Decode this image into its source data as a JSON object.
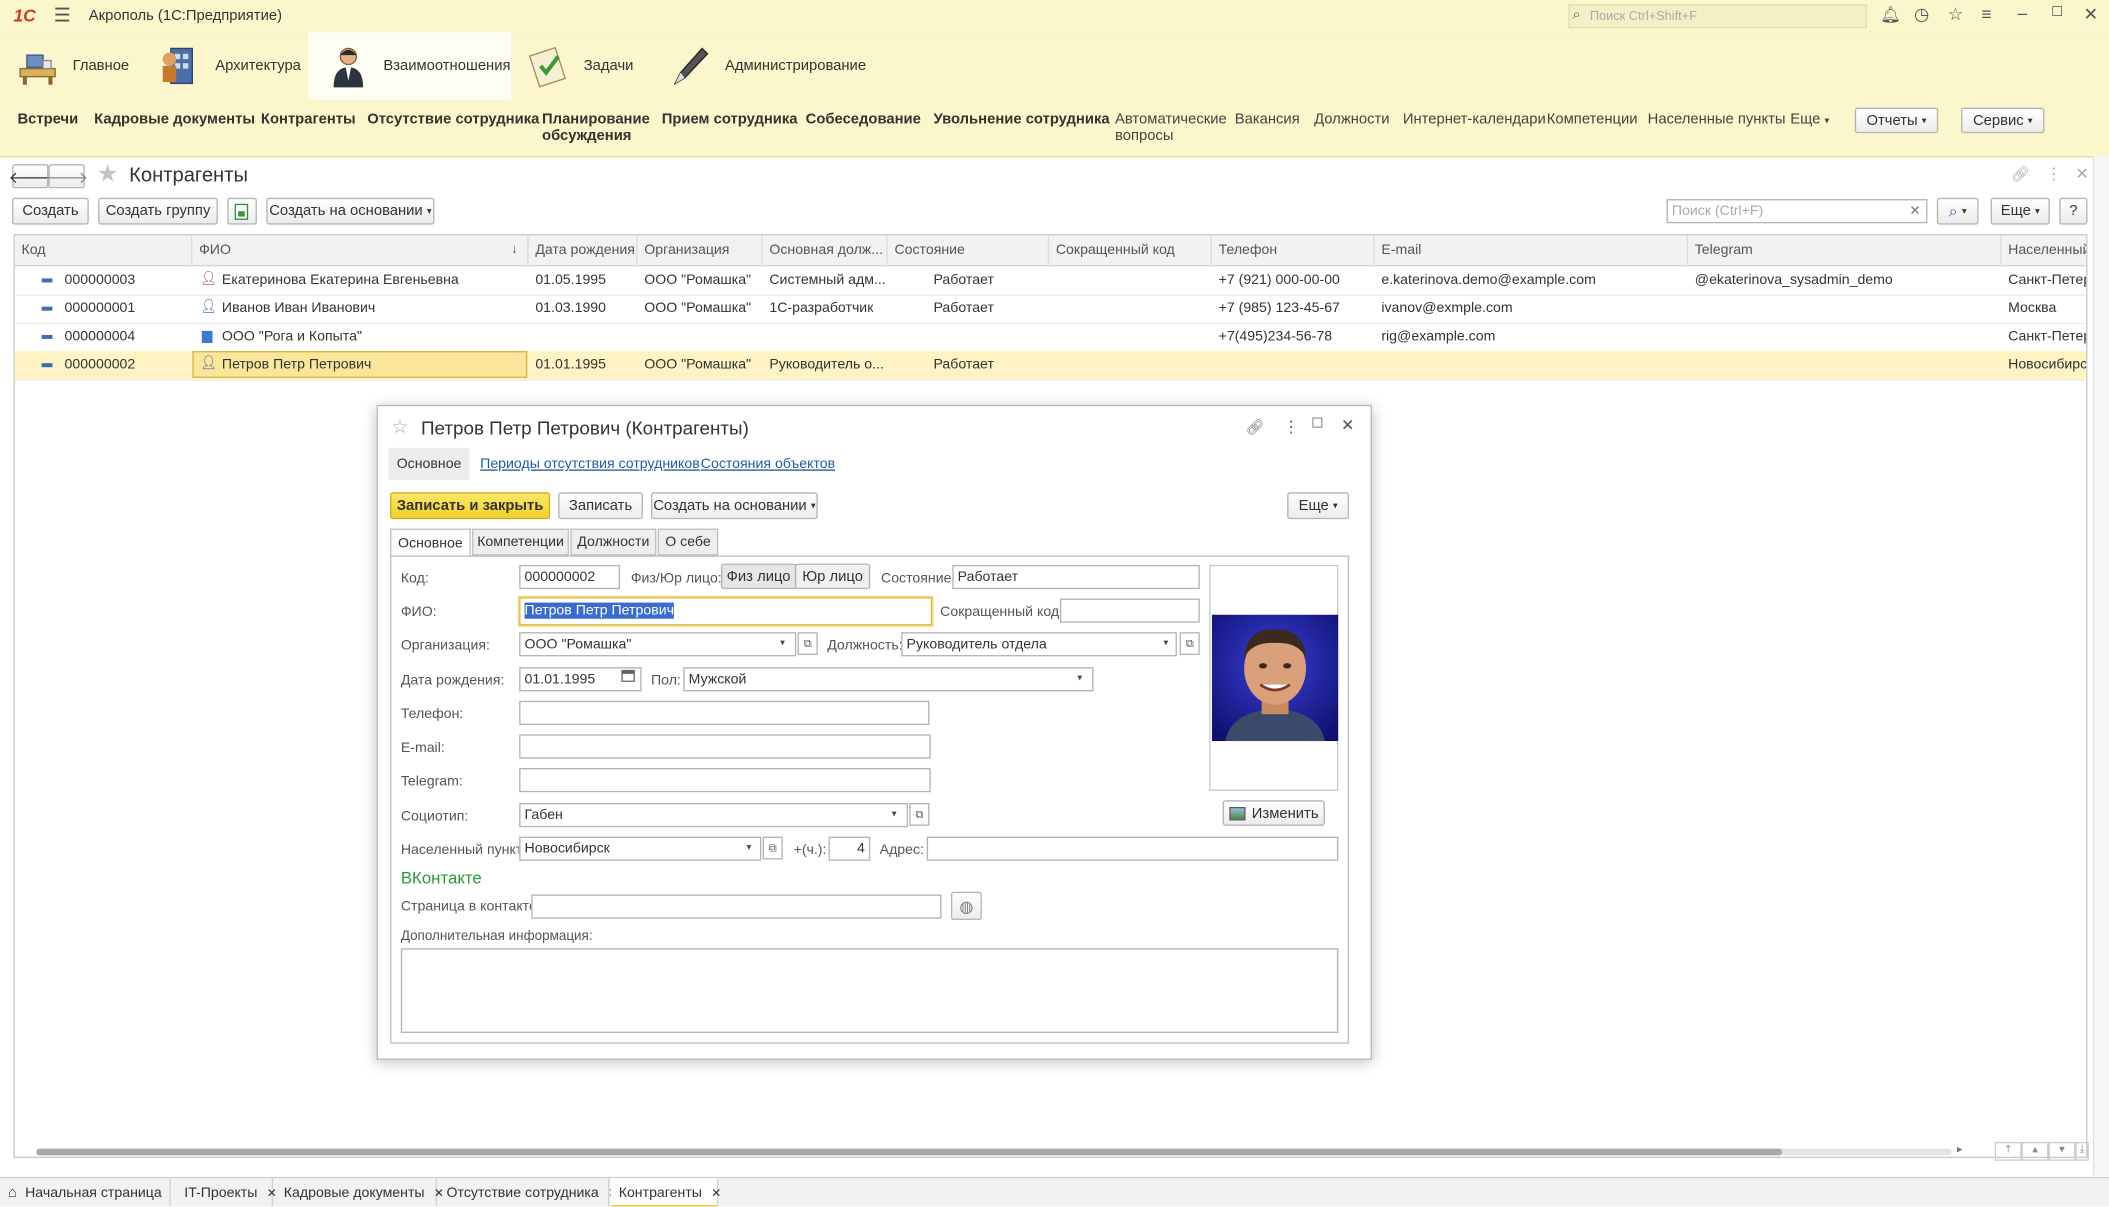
{
  "app": {
    "logo": "1С",
    "title": "Акрополь  (1С:Предприятие)",
    "search_placeholder": "Поиск Ctrl+Shift+F"
  },
  "sections": [
    {
      "label": "Главное",
      "icon": "desk-icon"
    },
    {
      "label": "Архитектура",
      "icon": "architecture-icon"
    },
    {
      "label": "Взаимоотношения",
      "icon": "person-icon"
    },
    {
      "label": "Задачи",
      "icon": "tasks-icon"
    },
    {
      "label": "Администрирование",
      "icon": "admin-icon"
    }
  ],
  "subnav": {
    "bold": [
      "Встречи",
      "Кадровые документы",
      "Контрагенты",
      "Отсутствие сотрудника",
      "Планирование",
      "обсуждения",
      "Прием сотрудника",
      "Собеседование",
      "Увольнение сотрудника"
    ],
    "normal": [
      "Автоматические",
      "вопросы",
      "Вакансия",
      "Должности",
      "Интернет-календари",
      "Компетенции",
      "Населенные пункты",
      "Еще"
    ],
    "reports": "Отчеты",
    "service": "Сервис"
  },
  "list": {
    "title": "Контрагенты",
    "create": "Создать",
    "create_group": "Создать группу",
    "create_based": "Создать на основании",
    "search_placeholder": "Поиск (Ctrl+F)",
    "more": "Еще",
    "help": "?",
    "columns": [
      "Код",
      "ФИО",
      "Дата рождения",
      "Организация",
      "Основная долж...",
      "Состояние",
      "Сокращенный код",
      "Телефон",
      "E-mail",
      "Telegram",
      "Населенный"
    ],
    "rows": [
      {
        "code": "000000003",
        "fio": "Екатеринова Екатерина Евгеньевна",
        "birth": "01.05.1995",
        "org": "ООО \"Ромашка\"",
        "pos": "Системный адм...",
        "state": "Работает",
        "short": "",
        "phone": "+7 (921) 000-00-00",
        "email": "e.katerinova.demo@example.com",
        "telegram": "@ekaterinova_sysadmin_demo",
        "city": "Санкт-Петерб",
        "kind": "person-female"
      },
      {
        "code": "000000001",
        "fio": "Иванов Иван Иванович",
        "birth": "01.03.1990",
        "org": "ООО \"Ромашка\"",
        "pos": "1С-разработчик",
        "state": "Работает",
        "short": "",
        "phone": "+7 (985) 123-45-67",
        "email": "ivanov@exmple.com",
        "telegram": "",
        "city": "Москва",
        "kind": "person"
      },
      {
        "code": "000000004",
        "fio": "ООО \"Рога и Копыта\"",
        "birth": "",
        "org": "",
        "pos": "",
        "state": "",
        "short": "",
        "phone": "+7(495)234-56-78",
        "email": "rig@example.com",
        "telegram": "",
        "city": "Санкт-Петерб",
        "kind": "company"
      },
      {
        "code": "000000002",
        "fio": "Петров Петр Петрович",
        "birth": "01.01.1995",
        "org": "ООО \"Ромашка\"",
        "pos": "Руководитель о...",
        "state": "Работает",
        "short": "",
        "phone": "",
        "email": "",
        "telegram": "",
        "city": "Новосибирск",
        "kind": "person"
      }
    ]
  },
  "dialog": {
    "title": "Петров Петр Петрович (Контрагенты)",
    "nav_tabs": [
      "Основное",
      "Периоды отсутствия сотрудников",
      "Состояния объектов"
    ],
    "save_close": "Записать и закрыть",
    "save": "Записать",
    "create_based": "Создать на основании",
    "more": "Еще",
    "tabs": [
      "Основное",
      "Компетенции",
      "Должности",
      "О себе"
    ],
    "labels": {
      "code": "Код:",
      "kind": "Физ/Юр лицо:",
      "state": "Состояние:",
      "fio": "ФИО:",
      "short_code": "Сокращенный код:",
      "org": "Организация:",
      "position": "Должность:",
      "birth": "Дата рождения:",
      "gender": "Пол:",
      "phone": "Телефон:",
      "email": "E-mail:",
      "telegram": "Telegram:",
      "socio": "Социотип:",
      "city": "Населенный пункт:",
      "tz": "+(ч.):",
      "address": "Адрес:",
      "vk_header": "ВКонтакте",
      "vk_page": "Страница в контакте:",
      "extra": "Дополнительная информация:"
    },
    "values": {
      "code": "000000002",
      "state": "Работает",
      "fio": "Петров Петр Петрович",
      "short_code": "",
      "org": "ООО \"Ромашка\"",
      "position": "Руководитель отдела",
      "birth": "01.01.1995",
      "gender": "Мужской",
      "phone": "",
      "email": "",
      "telegram": "",
      "socio": "Габен",
      "city": "Новосибирск",
      "tz": "4",
      "address": "",
      "vk_page": "",
      "extra": ""
    },
    "kind_options": [
      "Физ лицо",
      "Юр лицо"
    ],
    "change_photo": "Изменить"
  },
  "bottom_tabs": [
    "Начальная страница",
    "IT-Проекты",
    "Кадровые документы",
    "Отсутствие сотрудника",
    "Контрагенты"
  ],
  "colors": {
    "accent_yellow": "#f5dc3c",
    "header_bg": "#fbf6cc",
    "link": "#1e5ba8",
    "vk_green": "#2a9a3a"
  }
}
